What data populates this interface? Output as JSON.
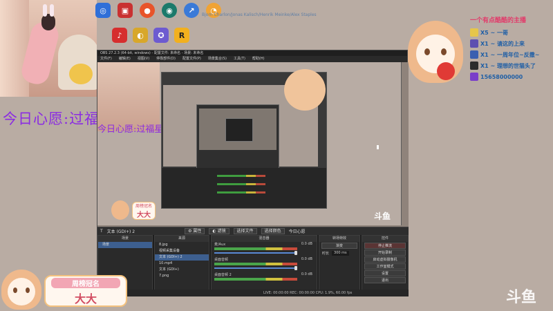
{
  "desktop": {
    "icons_row1": [
      {
        "name": "app1-icon",
        "color": "#2f6fd8",
        "glyph": "◎"
      },
      {
        "name": "app2-icon",
        "color": "#c93131",
        "glyph": "▣"
      },
      {
        "name": "app3-icon",
        "color": "#e8542a",
        "glyph": "●"
      },
      {
        "name": "app4-icon",
        "color": "#1b7a6b",
        "glyph": "◉"
      },
      {
        "name": "app5-icon",
        "color": "#3a7ad8",
        "glyph": "↗"
      },
      {
        "name": "app6-icon",
        "color": "#f0a334",
        "glyph": "◔"
      }
    ],
    "icons_row2": [
      {
        "name": "netease-music-icon",
        "color": "#d62e2e",
        "glyph": "♪"
      },
      {
        "name": "app8-icon",
        "color": "#d8a72a",
        "glyph": "◐"
      },
      {
        "name": "app9-icon",
        "color": "#6d5bd0",
        "glyph": "✪"
      },
      {
        "name": "rockstar-icon",
        "color": "#f2b01e",
        "glyph": "R"
      }
    ],
    "credits_text": "Bjorn Charlon/Jonas Kalisch/Henrik Meinke/Alex Staples"
  },
  "overlay": {
    "wish_text": "今日心愿:过福星",
    "rank_title": "一个有点酷酷的主播",
    "rank_items": [
      {
        "text": "X5 ~ 一哥",
        "color": "#3b6fc9"
      },
      {
        "text": "X1 ~ 请这的上来",
        "color": "#7a3ec9"
      },
      {
        "text": "X1 ~ 一周年位~反撒~",
        "color": "#c93e7a"
      },
      {
        "text": "X1 ~ 理想的世猫头了",
        "color": "#3ec98a"
      },
      {
        "text": "15658000000",
        "color": "#2a2a2a"
      }
    ],
    "crown_label": "周榜冠名",
    "crown_name": "大大",
    "watermark": "斗鱼"
  },
  "obs": {
    "title": "OBS 27.2.3 (64-bit, windows) - 配置文件: 未命名 - 场景: 未命名",
    "menu": [
      "文件(F)",
      "编辑(E)",
      "视图(V)",
      "停靠部件(D)",
      "配置文件(P)",
      "场景集合(S)",
      "工具(T)",
      "帮助(H)"
    ],
    "source_bar": {
      "current": "文本 (GDI+) 2",
      "props": "属性",
      "filters": "滤镜",
      "text_label": "今日心愿",
      "buttons": [
        "选择文件",
        "选择颜色"
      ]
    },
    "panels": {
      "scenes_title": "场景",
      "scenes": [
        "场景"
      ],
      "sources_title": "来源",
      "sources": [
        "8.jpg",
        "视频采集设备",
        "文本 (GDI+) 2",
        "10.mp4",
        "文本 (GDI+)",
        "7.png"
      ],
      "mixer_title": "混音器",
      "mixer": [
        {
          "name": "麦/Aux",
          "db": "0.0 dB"
        },
        {
          "name": "桌面音频",
          "db": "0.0 dB"
        },
        {
          "name": "桌面音频 2",
          "db": "0.0 dB"
        }
      ],
      "transitions_title": "转场特效",
      "transition": "渐变",
      "duration_label": "时长",
      "duration": "300 ms",
      "controls_title": "控件",
      "controls": [
        "停止推流",
        "开始录制",
        "启动虚拟摄像机",
        "工作室模式",
        "设置",
        "退出"
      ]
    },
    "status": "LIVE: 00:00:00   REC: 00:00:00   CPU: 1.9%, 60.00 fps"
  }
}
